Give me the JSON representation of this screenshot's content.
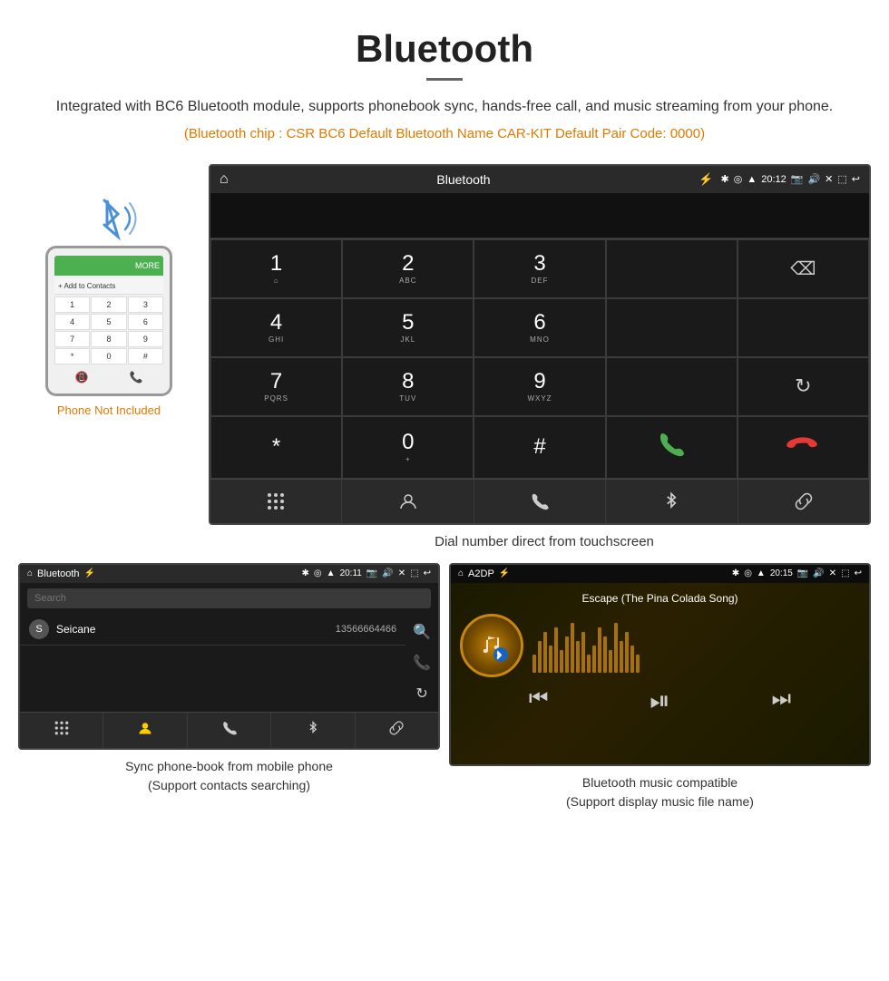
{
  "header": {
    "title": "Bluetooth",
    "description": "Integrated with BC6 Bluetooth module, supports phonebook sync, hands-free call, and music streaming from your phone.",
    "specs": "(Bluetooth chip : CSR BC6    Default Bluetooth Name CAR-KIT    Default Pair Code: 0000)"
  },
  "dial_screen": {
    "status_bar": {
      "home_icon": "⌂",
      "title": "Bluetooth",
      "usb_icon": "⚡",
      "bt_icon": "✱",
      "location_icon": "◎",
      "wifi_icon": "▲",
      "time": "20:12",
      "camera_icon": "📷",
      "volume_icon": "🔊",
      "close_icon": "✕",
      "window_icon": "⬚",
      "back_icon": "↩"
    },
    "keys": [
      {
        "main": "1",
        "sub": "⌂"
      },
      {
        "main": "2",
        "sub": "ABC"
      },
      {
        "main": "3",
        "sub": "DEF"
      },
      {
        "main": "",
        "sub": ""
      },
      {
        "main": "⌫",
        "sub": ""
      },
      {
        "main": "4",
        "sub": "GHI"
      },
      {
        "main": "5",
        "sub": "JKL"
      },
      {
        "main": "6",
        "sub": "MNO"
      },
      {
        "main": "",
        "sub": ""
      },
      {
        "main": "",
        "sub": ""
      },
      {
        "main": "7",
        "sub": "PQRS"
      },
      {
        "main": "8",
        "sub": "TUV"
      },
      {
        "main": "9",
        "sub": "WXYZ"
      },
      {
        "main": "",
        "sub": ""
      },
      {
        "main": "↻",
        "sub": ""
      },
      {
        "main": "*",
        "sub": ""
      },
      {
        "main": "0",
        "sub": "+"
      },
      {
        "main": "#",
        "sub": ""
      },
      {
        "main": "📞",
        "sub": ""
      },
      {
        "main": "📵",
        "sub": ""
      }
    ],
    "bottom_nav": [
      "⊞",
      "👤",
      "📞",
      "✱",
      "🔗"
    ],
    "caption": "Dial number direct from touchscreen"
  },
  "phonebook_screen": {
    "status_bar_title": "Bluetooth",
    "time": "20:11",
    "search_placeholder": "Search",
    "contact": {
      "initial": "S",
      "name": "Seicane",
      "number": "13566664466"
    },
    "side_icons": [
      "🔍",
      "📞",
      "↻"
    ],
    "bottom_nav": [
      "⊞",
      "👤",
      "📞",
      "✱",
      "🔗"
    ],
    "caption": "Sync phone-book from mobile phone\n(Support contacts searching)"
  },
  "music_screen": {
    "status_bar_title": "A2DP",
    "time": "20:15",
    "song_title": "Escape (The Pina Colada Song)",
    "controls": [
      "⏮",
      "⏯",
      "⏭"
    ],
    "caption": "Bluetooth music compatible\n(Support display music file name)"
  },
  "phone_not_included": "Phone Not Included",
  "dial_keys_labels": {
    "1_sub": "⌂",
    "2_sub": "ABC",
    "3_sub": "DEF",
    "4_sub": "GHI",
    "5_sub": "JKL",
    "6_sub": "MNO",
    "7_sub": "PQRS",
    "8_sub": "TUV",
    "9_sub": "WXYZ",
    "0_sub": "+"
  }
}
